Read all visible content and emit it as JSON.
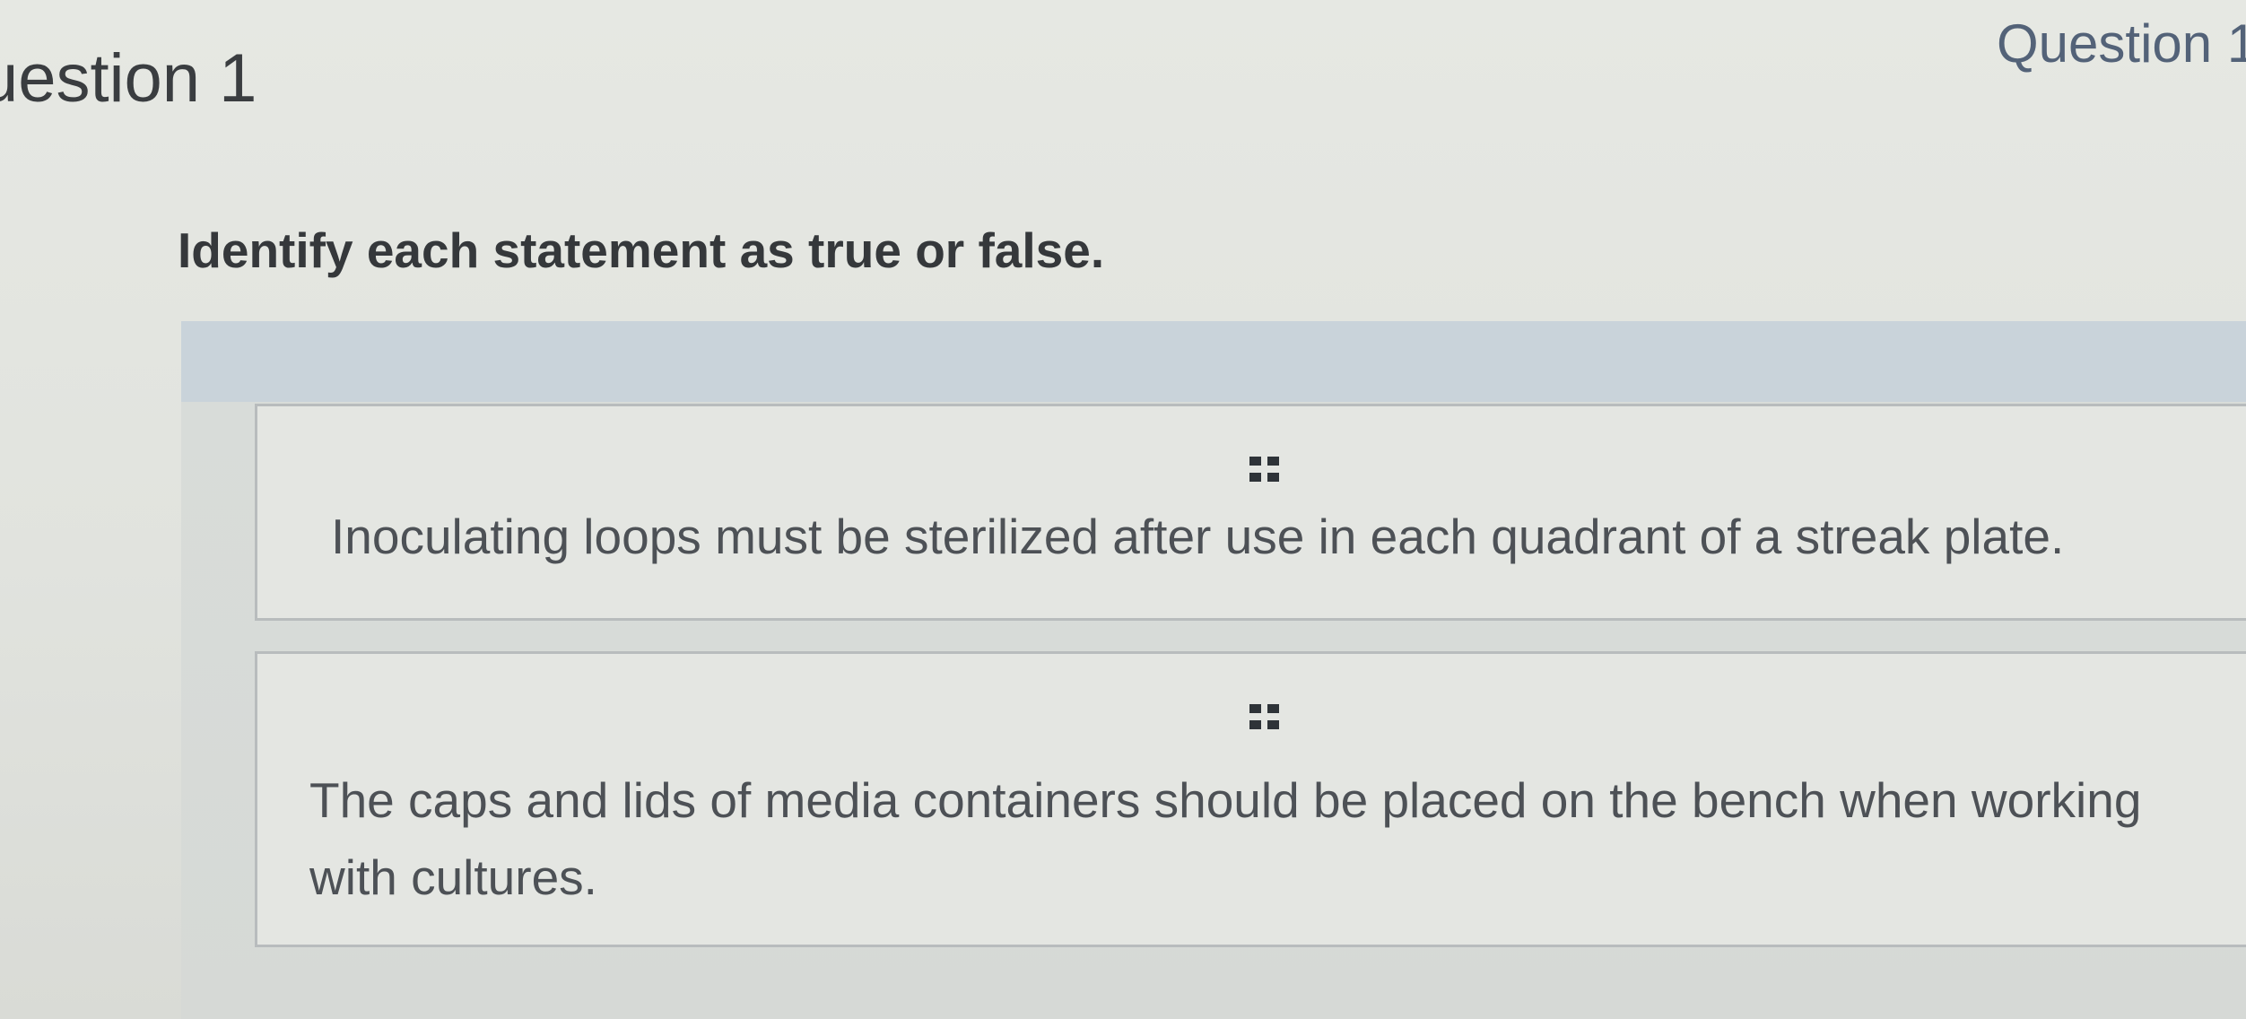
{
  "header": {
    "left_title": "uestion 1",
    "right_title": "Question 1"
  },
  "question": {
    "instruction": "Identify each statement as true or false."
  },
  "statements": [
    {
      "grip_icon": "drag-handle-icon",
      "text": "Inoculating loops must be sterilized after use in each quadrant of a streak plate."
    },
    {
      "grip_icon": "drag-handle-icon",
      "text": "The caps and lids of media containers should be placed on the bench when working with cultures."
    }
  ],
  "colors": {
    "background": "#e4e6e1",
    "drop_zone_header": "#c9d3da",
    "card_border": "#b8bcbd",
    "statement_text": "#4d5156",
    "heading_blue": "#536278"
  }
}
